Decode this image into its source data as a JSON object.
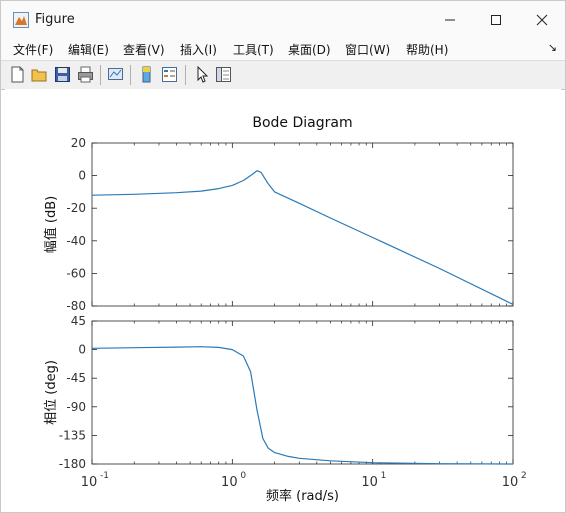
{
  "window": {
    "title": "Figure"
  },
  "menu": [
    "文件(F)",
    "编辑(E)",
    "查看(V)",
    "插入(I)",
    "工具(T)",
    "桌面(D)",
    "窗口(W)",
    "帮助(H)"
  ],
  "toolbar": {
    "icons": [
      "new-figure-icon",
      "open-file-icon",
      "save-icon",
      "print-icon",
      "link-plot-icon",
      "insert-colorbar-icon",
      "insert-legend-icon",
      "edit-plot-icon",
      "property-inspector-icon"
    ]
  },
  "colors": {
    "line": "#2a7ab8",
    "axis": "#262626",
    "grid_tick": "#6e6e6e"
  },
  "chart_data": {
    "type": "line",
    "title": "Bode Diagram",
    "xlabel": "频率  (rad/s)",
    "xscale": "log",
    "xlim": [
      0.1,
      100
    ],
    "xticks": [
      "10",
      "10",
      "10",
      "10"
    ],
    "xtick_exponents": [
      "-1",
      "0",
      "1",
      "2"
    ],
    "panels": [
      {
        "ylabel": "幅值 (dB)",
        "ylim": [
          -80,
          20
        ],
        "yticks": [
          "20",
          "0",
          "-20",
          "-40",
          "-60",
          "-80"
        ],
        "x": [
          0.1,
          0.2,
          0.4,
          0.6,
          0.8,
          1.0,
          1.2,
          1.4,
          1.5,
          1.6,
          1.8,
          2.0,
          3.0,
          5.0,
          10,
          30,
          100
        ],
        "y": [
          -12,
          -11.5,
          -10.5,
          -9.5,
          -8,
          -6,
          -3,
          1,
          3,
          2,
          -5,
          -10,
          -17,
          -26,
          -38,
          -57,
          -79
        ]
      },
      {
        "ylabel": "相位 (deg)",
        "ylim": [
          -180,
          45
        ],
        "yticks": [
          "45",
          "0",
          "-45",
          "-90",
          "-135",
          "-180"
        ],
        "x": [
          0.1,
          0.2,
          0.4,
          0.6,
          0.8,
          1.0,
          1.2,
          1.35,
          1.5,
          1.65,
          1.8,
          2.0,
          2.5,
          3.0,
          5.0,
          10,
          30,
          100
        ],
        "y": [
          2,
          3,
          4,
          4.5,
          3.5,
          0,
          -10,
          -35,
          -95,
          -140,
          -155,
          -162,
          -168,
          -171,
          -175,
          -178,
          -179.5,
          -180
        ]
      }
    ]
  }
}
